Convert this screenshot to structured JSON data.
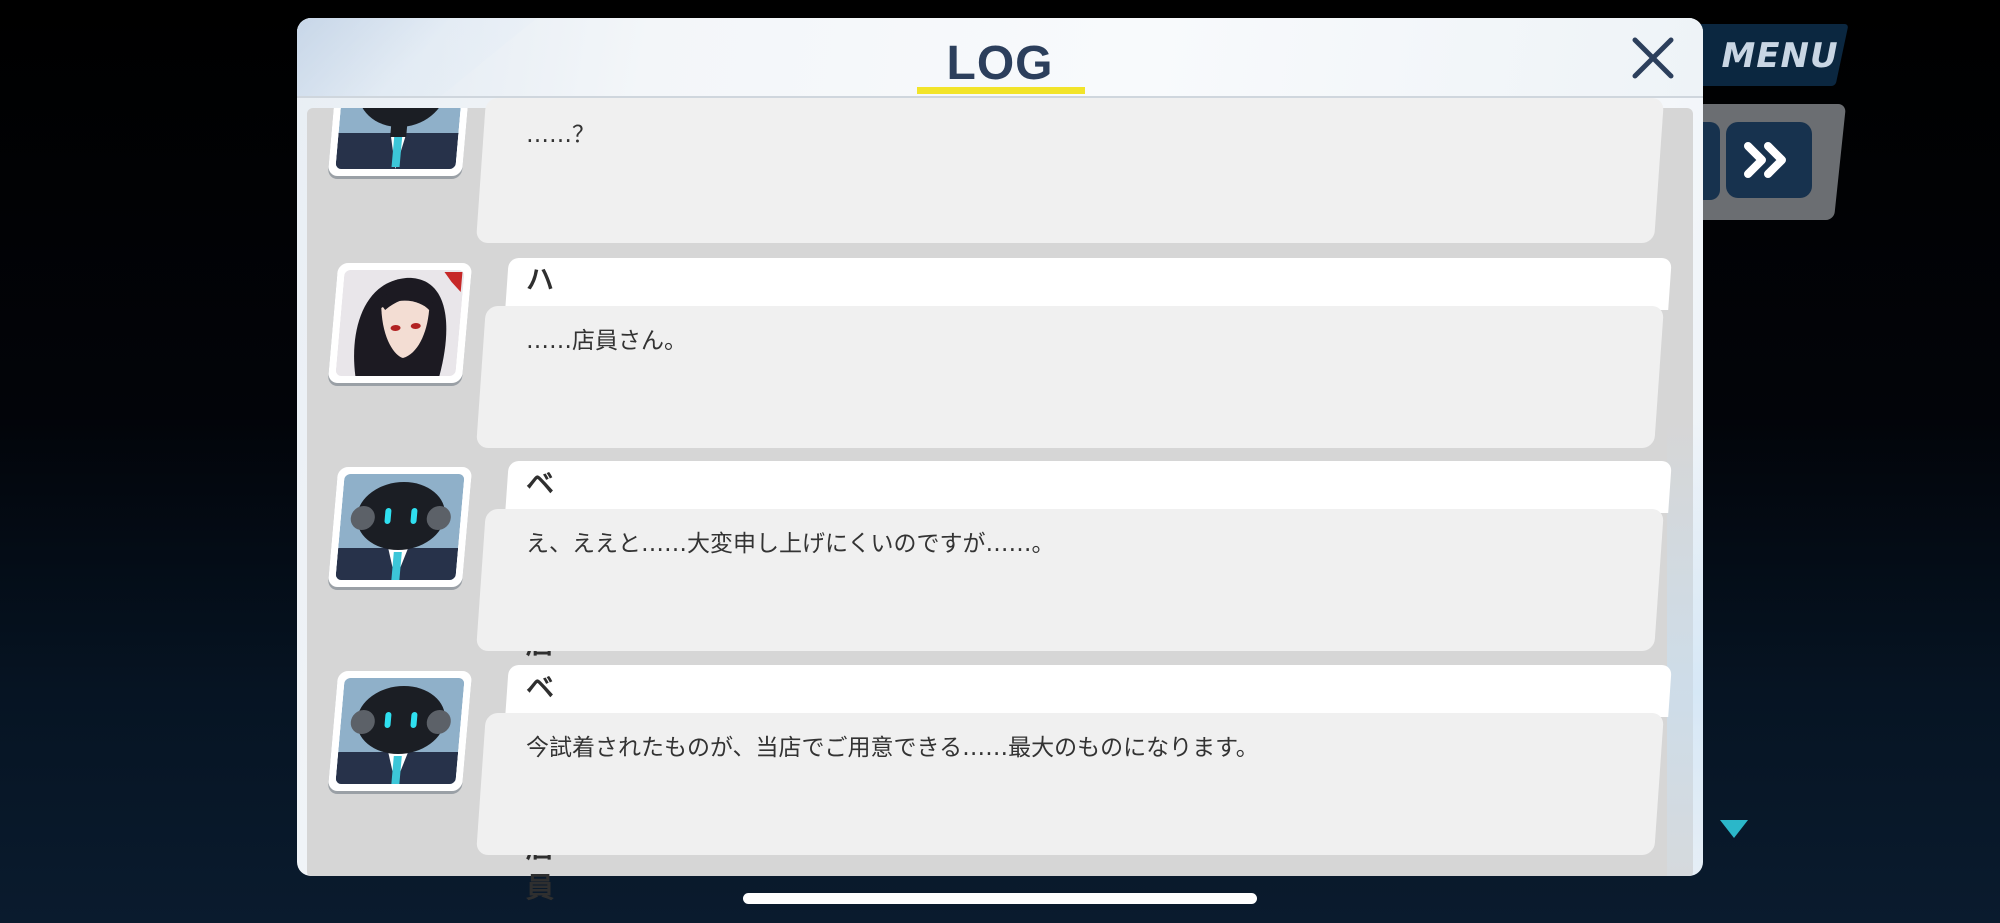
{
  "background": {
    "menu_label": "MENU",
    "fast_forward_icon": "fast-forward-icon",
    "scroll_indicator_icon": "down-triangle-icon"
  },
  "modal": {
    "title": "LOG",
    "close_icon": "close-icon",
    "accent_color": "#f2e42a",
    "title_color": "#2c3f5c"
  },
  "entries": [
    {
      "speaker": "",
      "message": "……？",
      "avatar_icon": "robot-avatar-icon"
    },
    {
      "speaker": "ハスミ",
      "message": "……店員さん。",
      "avatar_icon": "girl-avatar-icon"
    },
    {
      "speaker": "ベロニカ店員",
      "message": "え、ええと……大変申し上げにくいのですが……。",
      "avatar_icon": "robot-avatar-icon"
    },
    {
      "speaker": "ベロニカ店員",
      "message": "今試着されたものが、当店でご用意できる……最大のものになります。",
      "avatar_icon": "robot-avatar-icon"
    }
  ]
}
